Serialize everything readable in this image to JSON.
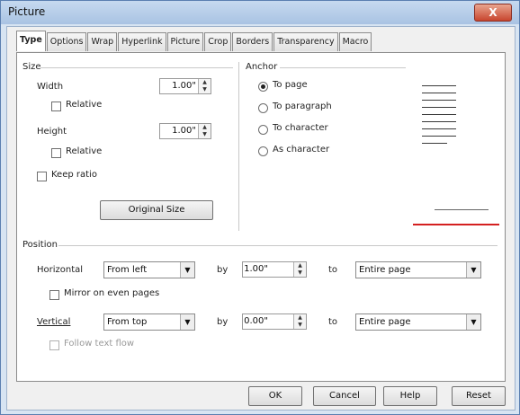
{
  "window": {
    "title": "Picture",
    "close_label": "X"
  },
  "tabs": [
    "Type",
    "Options",
    "Wrap",
    "Hyperlink",
    "Picture",
    "Crop",
    "Borders",
    "Transparency",
    "Macro"
  ],
  "size": {
    "legend": "Size",
    "width_label": "Width",
    "width_value": "1.00\"",
    "relative_width": "Relative",
    "height_label": "Height",
    "height_value": "1.00\"",
    "relative_height": "Relative",
    "keep_ratio": "Keep ratio",
    "original_size": "Original Size"
  },
  "anchor": {
    "legend": "Anchor",
    "options": [
      "To page",
      "To paragraph",
      "To character",
      "As character"
    ],
    "selected": "To page"
  },
  "position": {
    "legend": "Position",
    "horizontal_label": "Horizontal",
    "horizontal_value": "From left",
    "h_by_label": "by",
    "h_by_value": "1.00\"",
    "h_to_label": "to",
    "h_to_value": "Entire page",
    "mirror_label": "Mirror on even pages",
    "vertical_label": "Vertical",
    "vertical_value": "From top",
    "v_by_label": "by",
    "v_by_value": "0.00\"",
    "v_to_label": "to",
    "v_to_value": "Entire page",
    "follow_label": "Follow text flow"
  },
  "buttons": {
    "ok": "OK",
    "cancel": "Cancel",
    "help": "Help",
    "reset": "Reset"
  },
  "colors": {
    "accent_red": "#d42020",
    "title_bg": "#b9cfe9"
  }
}
